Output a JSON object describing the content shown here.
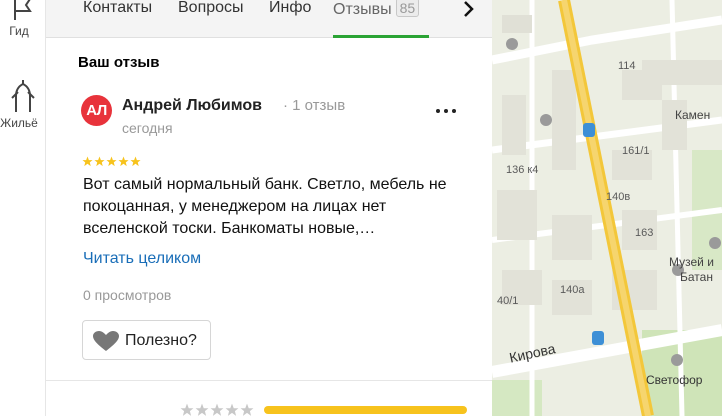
{
  "rail": {
    "items": [
      {
        "label": "Гид",
        "icon": "flag-icon"
      },
      {
        "label": "Жильё",
        "icon": "hands-icon"
      }
    ]
  },
  "tabs": [
    {
      "label": "Контакты"
    },
    {
      "label": "Вопросы"
    },
    {
      "label": "Инфо"
    },
    {
      "label": "Отзывы",
      "badge": "85",
      "active": true
    }
  ],
  "review_section": {
    "title": "Ваш отзыв"
  },
  "review": {
    "avatar_initials": "АЛ",
    "author": "Андрей Любимов",
    "author_reviews": "· 1 отзыв",
    "date": "сегодня",
    "rating": 5,
    "text": "Вот самый нормальный банк. Светло, мебель не покоцанная, у менеджером на лицах нет вселенской тоски. Банкоматы новые,…",
    "read_more": "Читать целиком",
    "views": "0 просмотров",
    "useful_label": "Полезно?"
  },
  "colors": {
    "accent_green": "#2aa334",
    "avatar_red": "#e8333b",
    "star_yellow": "#f7c31d",
    "link_blue": "#1a6eb8"
  },
  "map": {
    "labels": [
      {
        "text": "114"
      },
      {
        "text": "Камен"
      },
      {
        "text": "161/1"
      },
      {
        "text": "136 к4"
      },
      {
        "text": "140в"
      },
      {
        "text": "163"
      },
      {
        "text": "Музей и"
      },
      {
        "text": "Батан"
      },
      {
        "text": "140а"
      },
      {
        "text": "40/1"
      },
      {
        "text": "Светофор"
      }
    ],
    "street": "Кирова"
  }
}
